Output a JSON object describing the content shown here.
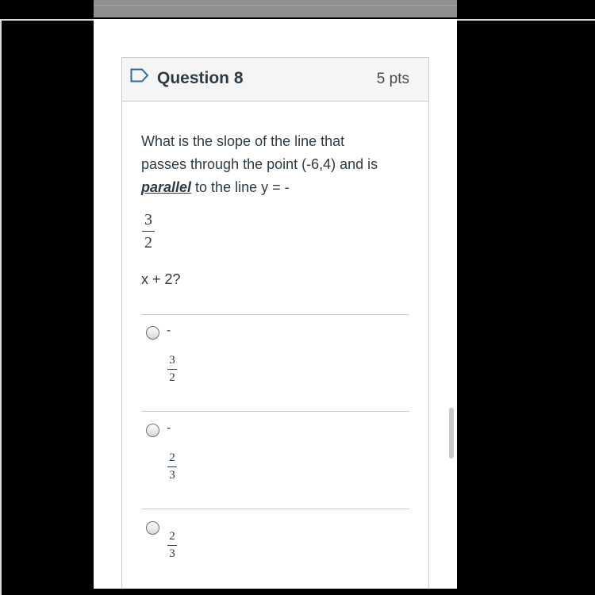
{
  "question": {
    "title": "Question 8",
    "points": "5 pts",
    "text_line1": "What is the slope of the line that",
    "text_line2": "passes through the  point (-6,4) and is",
    "text_emphasis": "parallel",
    "text_line3_rest": " to the line y = -",
    "equation_fraction": {
      "numerator": "3",
      "denominator": "2"
    },
    "text_after_fraction": "x + 2?"
  },
  "answers": [
    {
      "sign": "-",
      "numerator": "3",
      "denominator": "2",
      "selected": false
    },
    {
      "sign": "-",
      "numerator": "2",
      "denominator": "3",
      "selected": false
    },
    {
      "sign": "",
      "numerator": "2",
      "denominator": "3",
      "selected": false
    }
  ],
  "colors": {
    "text": "#2d3b45",
    "header_bg": "#f5f5f5",
    "border": "#c7cdd1",
    "flag": "#2d6ca8"
  },
  "icons": {
    "question_flag": "flag-outline-icon",
    "answer_control": "radio-button-icon"
  }
}
